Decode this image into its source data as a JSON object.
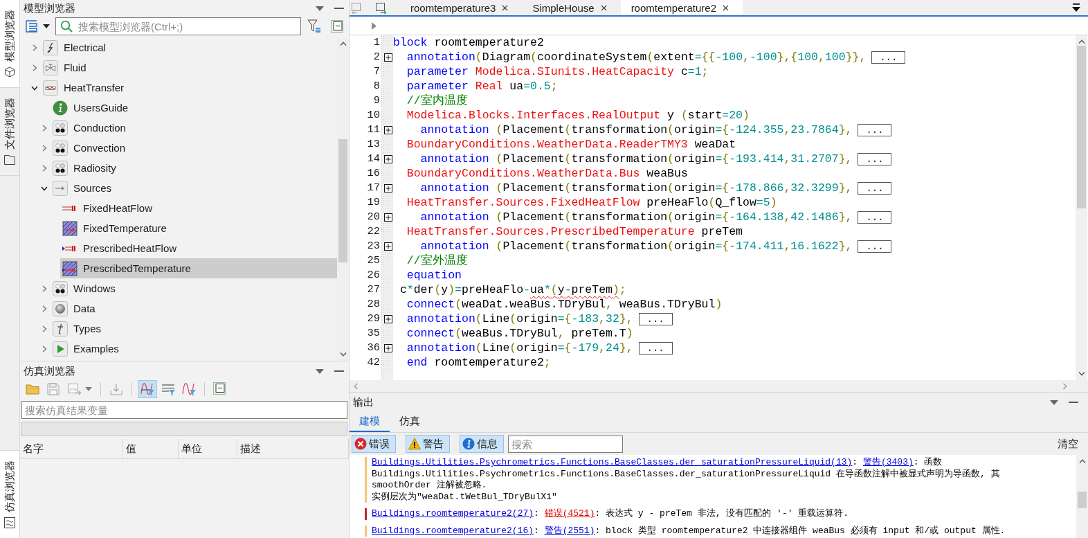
{
  "side_tabs": {
    "top": [
      {
        "label": "模型浏览器",
        "kind": "cube",
        "selected": true
      },
      {
        "label": "文件浏览器",
        "kind": "folder",
        "selected": false
      }
    ],
    "bottom": [
      {
        "label": "仿真浏览器",
        "kind": "wave",
        "selected": true
      }
    ]
  },
  "model_browser": {
    "title": "模型浏览器",
    "search": {
      "placeholder": "搜索模型浏览器(Ctrl+;)"
    },
    "tree": [
      {
        "label": "Electrical",
        "kind": "bolt",
        "expanded": false,
        "selected": false
      },
      {
        "label": "Fluid",
        "kind": "valve",
        "expanded": false,
        "selected": false
      },
      {
        "label": "HeatTransfer",
        "kind": "heat",
        "expanded": true,
        "selected": false,
        "children": [
          {
            "label": "UsersGuide",
            "kind": "info",
            "selected": false
          },
          {
            "label": "Conduction",
            "kind": "dots",
            "expanded": false,
            "selected": false
          },
          {
            "label": "Convection",
            "kind": "dots",
            "expanded": false,
            "selected": false
          },
          {
            "label": "Radiosity",
            "kind": "dots",
            "expanded": false,
            "selected": false
          },
          {
            "label": "Sources",
            "kind": "arrow",
            "expanded": true,
            "selected": false,
            "children": [
              {
                "label": "FixedHeatFlow",
                "kind": "flow",
                "selected": false
              },
              {
                "label": "FixedTemperature",
                "kind": "hatch",
                "selected": false
              },
              {
                "label": "PrescribedHeatFlow",
                "kind": "inflow",
                "selected": false
              },
              {
                "label": "PrescribedTemperature",
                "kind": "hatchin",
                "selected": true
              }
            ]
          },
          {
            "label": "Windows",
            "kind": "dots",
            "expanded": false,
            "selected": false
          },
          {
            "label": "Data",
            "kind": "disc",
            "expanded": false,
            "selected": false
          },
          {
            "label": "Types",
            "kind": "letter",
            "expanded": false,
            "selected": false
          },
          {
            "label": "Examples",
            "kind": "play",
            "expanded": false,
            "selected": false
          }
        ]
      }
    ]
  },
  "simulation_browser": {
    "title": "仿真浏览器",
    "toolbar": [
      {
        "kind": "open",
        "disabled": false,
        "selected": false
      },
      {
        "kind": "save",
        "disabled": true,
        "selected": false
      },
      {
        "kind": "export",
        "disabled": true,
        "selected": false
      },
      {
        "kind": "separator"
      },
      {
        "kind": "import",
        "disabled": true,
        "selected": false
      },
      {
        "kind": "separator"
      },
      {
        "kind": "plot",
        "disabled": false,
        "selected": true
      },
      {
        "kind": "list",
        "disabled": false,
        "selected": false
      },
      {
        "kind": "curve",
        "disabled": false,
        "selected": false
      },
      {
        "kind": "separator"
      },
      {
        "kind": "collapse",
        "disabled": false,
        "selected": false
      }
    ],
    "search": {
      "placeholder": "搜索仿真结果变量"
    },
    "table": {
      "columns": [
        "名字",
        "值",
        "单位",
        "描述"
      ]
    }
  },
  "editor": {
    "tabs": [
      {
        "label": "roomtemperature3",
        "selected": false
      },
      {
        "label": "SimpleHouse",
        "selected": false
      },
      {
        "label": "roomtemperature2",
        "selected": true
      }
    ],
    "lines": [
      {
        "number": "1",
        "segments": [
          {
            "kind": "keyword",
            "text": "block"
          },
          {
            "kind": "text",
            "text": " roomtemperature2"
          }
        ]
      },
      {
        "number": "2",
        "folded": true,
        "ellipsis": "...",
        "segments": [
          {
            "kind": "keyword",
            "text": "  annotation"
          },
          {
            "kind": "bracket",
            "text": "("
          },
          {
            "kind": "text",
            "text": "Diagram"
          },
          {
            "kind": "bracket",
            "text": "("
          },
          {
            "kind": "text",
            "text": "coordinateSystem"
          },
          {
            "kind": "bracket",
            "text": "("
          },
          {
            "kind": "text",
            "text": "extent"
          },
          {
            "kind": "number",
            "text": "="
          },
          {
            "kind": "bracket",
            "text": "{{"
          },
          {
            "kind": "number",
            "text": "-100"
          },
          {
            "kind": "bracket",
            "text": ","
          },
          {
            "kind": "number",
            "text": "-100"
          },
          {
            "kind": "bracket",
            "text": "},{"
          },
          {
            "kind": "number",
            "text": "100"
          },
          {
            "kind": "bracket",
            "text": ","
          },
          {
            "kind": "number",
            "text": "100"
          },
          {
            "kind": "bracket",
            "text": "}},"
          }
        ]
      },
      {
        "number": "7",
        "segments": [
          {
            "kind": "keyword",
            "text": "  parameter"
          },
          {
            "kind": "type",
            "text": " Modelica.SIunits.HeatCapacity"
          },
          {
            "kind": "text",
            "text": " c"
          },
          {
            "kind": "number",
            "text": "=1"
          },
          {
            "kind": "bracket",
            "text": ";"
          }
        ]
      },
      {
        "number": "8",
        "segments": [
          {
            "kind": "keyword",
            "text": "  parameter"
          },
          {
            "kind": "type",
            "text": " Real"
          },
          {
            "kind": "text",
            "text": " ua"
          },
          {
            "kind": "number",
            "text": "=0.5"
          },
          {
            "kind": "bracket",
            "text": ";"
          }
        ]
      },
      {
        "number": "9",
        "segments": [
          {
            "kind": "comment",
            "text": "  //室内温度"
          }
        ]
      },
      {
        "number": "10",
        "segments": [
          {
            "kind": "type",
            "text": "  Modelica.Blocks.Interfaces.RealOutput"
          },
          {
            "kind": "text",
            "text": " y "
          },
          {
            "kind": "bracket",
            "text": "("
          },
          {
            "kind": "text",
            "text": "start"
          },
          {
            "kind": "number",
            "text": "=20"
          },
          {
            "kind": "bracket",
            "text": ")"
          }
        ]
      },
      {
        "number": "11",
        "folded": true,
        "ellipsis": "...",
        "segments": [
          {
            "kind": "keyword",
            "text": "    annotation"
          },
          {
            "kind": "bracket",
            "text": " ("
          },
          {
            "kind": "text",
            "text": "Placement"
          },
          {
            "kind": "bracket",
            "text": "("
          },
          {
            "kind": "text",
            "text": "transformation"
          },
          {
            "kind": "bracket",
            "text": "("
          },
          {
            "kind": "text",
            "text": "origin"
          },
          {
            "kind": "number",
            "text": "="
          },
          {
            "kind": "bracket",
            "text": "{"
          },
          {
            "kind": "number",
            "text": "-124.355"
          },
          {
            "kind": "bracket",
            "text": ","
          },
          {
            "kind": "number",
            "text": "23.7864"
          },
          {
            "kind": "bracket",
            "text": "},"
          }
        ]
      },
      {
        "number": "13",
        "segments": [
          {
            "kind": "type",
            "text": "  BoundaryConditions.WeatherData.ReaderTMY3"
          },
          {
            "kind": "text",
            "text": " weaDat"
          }
        ]
      },
      {
        "number": "14",
        "folded": true,
        "ellipsis": "...",
        "segments": [
          {
            "kind": "keyword",
            "text": "    annotation"
          },
          {
            "kind": "bracket",
            "text": " ("
          },
          {
            "kind": "text",
            "text": "Placement"
          },
          {
            "kind": "bracket",
            "text": "("
          },
          {
            "kind": "text",
            "text": "transformation"
          },
          {
            "kind": "bracket",
            "text": "("
          },
          {
            "kind": "text",
            "text": "origin"
          },
          {
            "kind": "number",
            "text": "="
          },
          {
            "kind": "bracket",
            "text": "{"
          },
          {
            "kind": "number",
            "text": "-193.414"
          },
          {
            "kind": "bracket",
            "text": ","
          },
          {
            "kind": "number",
            "text": "31.2707"
          },
          {
            "kind": "bracket",
            "text": "},"
          }
        ]
      },
      {
        "number": "16",
        "segments": [
          {
            "kind": "type",
            "text": "  BoundaryConditions.WeatherData.Bus"
          },
          {
            "kind": "text",
            "text": " weaBus"
          }
        ]
      },
      {
        "number": "17",
        "folded": true,
        "ellipsis": "...",
        "segments": [
          {
            "kind": "keyword",
            "text": "    annotation"
          },
          {
            "kind": "bracket",
            "text": " ("
          },
          {
            "kind": "text",
            "text": "Placement"
          },
          {
            "kind": "bracket",
            "text": "("
          },
          {
            "kind": "text",
            "text": "transformation"
          },
          {
            "kind": "bracket",
            "text": "("
          },
          {
            "kind": "text",
            "text": "origin"
          },
          {
            "kind": "number",
            "text": "="
          },
          {
            "kind": "bracket",
            "text": "{"
          },
          {
            "kind": "number",
            "text": "-178.866"
          },
          {
            "kind": "bracket",
            "text": ","
          },
          {
            "kind": "number",
            "text": "32.3299"
          },
          {
            "kind": "bracket",
            "text": "},"
          }
        ]
      },
      {
        "number": "19",
        "segments": [
          {
            "kind": "type",
            "text": "  HeatTransfer.Sources.FixedHeatFlow"
          },
          {
            "kind": "text",
            "text": " preHeaFlo"
          },
          {
            "kind": "bracket",
            "text": "("
          },
          {
            "kind": "text",
            "text": "Q_flow"
          },
          {
            "kind": "number",
            "text": "=5"
          },
          {
            "kind": "bracket",
            "text": ")"
          }
        ]
      },
      {
        "number": "20",
        "folded": true,
        "ellipsis": "...",
        "segments": [
          {
            "kind": "keyword",
            "text": "    annotation"
          },
          {
            "kind": "bracket",
            "text": " ("
          },
          {
            "kind": "text",
            "text": "Placement"
          },
          {
            "kind": "bracket",
            "text": "("
          },
          {
            "kind": "text",
            "text": "transformation"
          },
          {
            "kind": "bracket",
            "text": "("
          },
          {
            "kind": "text",
            "text": "origin"
          },
          {
            "kind": "number",
            "text": "="
          },
          {
            "kind": "bracket",
            "text": "{"
          },
          {
            "kind": "number",
            "text": "-164.138"
          },
          {
            "kind": "bracket",
            "text": ","
          },
          {
            "kind": "number",
            "text": "42.1486"
          },
          {
            "kind": "bracket",
            "text": "},"
          }
        ]
      },
      {
        "number": "22",
        "segments": [
          {
            "kind": "type",
            "text": "  HeatTransfer.Sources.PrescribedTemperature"
          },
          {
            "kind": "text",
            "text": " preTem"
          }
        ]
      },
      {
        "number": "23",
        "folded": true,
        "ellipsis": "...",
        "segments": [
          {
            "kind": "keyword",
            "text": "    annotation"
          },
          {
            "kind": "bracket",
            "text": " ("
          },
          {
            "kind": "text",
            "text": "Placement"
          },
          {
            "kind": "bracket",
            "text": "("
          },
          {
            "kind": "text",
            "text": "transformation"
          },
          {
            "kind": "bracket",
            "text": "("
          },
          {
            "kind": "text",
            "text": "origin"
          },
          {
            "kind": "number",
            "text": "="
          },
          {
            "kind": "bracket",
            "text": "{"
          },
          {
            "kind": "number",
            "text": "-174.411"
          },
          {
            "kind": "bracket",
            "text": ","
          },
          {
            "kind": "number",
            "text": "16.1622"
          },
          {
            "kind": "bracket",
            "text": "},"
          }
        ]
      },
      {
        "number": "25",
        "segments": [
          {
            "kind": "comment",
            "text": "  //室外温度"
          }
        ]
      },
      {
        "number": "26",
        "segments": [
          {
            "kind": "keyword",
            "text": "  equation"
          }
        ]
      },
      {
        "number": "27",
        "segments": [
          {
            "kind": "text",
            "text": " c"
          },
          {
            "kind": "number",
            "text": "*"
          },
          {
            "kind": "text",
            "text": "der"
          },
          {
            "kind": "bracket",
            "text": "("
          },
          {
            "kind": "text",
            "text": "y"
          },
          {
            "kind": "bracket",
            "text": ")"
          },
          {
            "kind": "number",
            "text": "="
          },
          {
            "kind": "text",
            "text": "preHeaFlo"
          },
          {
            "kind": "number",
            "text": "-"
          },
          {
            "kind": "text",
            "text": "ua",
            "error": true
          },
          {
            "kind": "number",
            "text": "*",
            "error": true
          },
          {
            "kind": "bracket",
            "text": "(",
            "error": true
          },
          {
            "kind": "text",
            "text": "y",
            "error": true
          },
          {
            "kind": "number",
            "text": "-",
            "error": true
          },
          {
            "kind": "text",
            "text": "preTem",
            "error": true
          },
          {
            "kind": "bracket",
            "text": ")",
            "error": true
          },
          {
            "kind": "bracket",
            "text": ";"
          }
        ]
      },
      {
        "number": "28",
        "segments": [
          {
            "kind": "keyword",
            "text": "  connect"
          },
          {
            "kind": "bracket",
            "text": "("
          },
          {
            "kind": "text",
            "text": "weaDat.weaBus.TDryBul"
          },
          {
            "kind": "bracket",
            "text": ","
          },
          {
            "kind": "text",
            "text": " weaBus.TDryBul"
          },
          {
            "kind": "bracket",
            "text": ")"
          }
        ]
      },
      {
        "number": "29",
        "folded": true,
        "ellipsis": "...",
        "segments": [
          {
            "kind": "keyword",
            "text": "  annotation"
          },
          {
            "kind": "bracket",
            "text": "("
          },
          {
            "kind": "text",
            "text": "Line"
          },
          {
            "kind": "bracket",
            "text": "("
          },
          {
            "kind": "text",
            "text": "origin"
          },
          {
            "kind": "number",
            "text": "="
          },
          {
            "kind": "bracket",
            "text": "{"
          },
          {
            "kind": "number",
            "text": "-183"
          },
          {
            "kind": "bracket",
            "text": ","
          },
          {
            "kind": "number",
            "text": "32"
          },
          {
            "kind": "bracket",
            "text": "},"
          }
        ]
      },
      {
        "number": "35",
        "segments": [
          {
            "kind": "keyword",
            "text": "  connect"
          },
          {
            "kind": "bracket",
            "text": "("
          },
          {
            "kind": "text",
            "text": "weaBus.TDryBul"
          },
          {
            "kind": "bracket",
            "text": ","
          },
          {
            "kind": "text",
            "text": " preTem.T"
          },
          {
            "kind": "bracket",
            "text": ")"
          }
        ]
      },
      {
        "number": "36",
        "folded": true,
        "ellipsis": "...",
        "segments": [
          {
            "kind": "keyword",
            "text": "  annotation"
          },
          {
            "kind": "bracket",
            "text": "("
          },
          {
            "kind": "text",
            "text": "Line"
          },
          {
            "kind": "bracket",
            "text": "("
          },
          {
            "kind": "text",
            "text": "origin"
          },
          {
            "kind": "number",
            "text": "="
          },
          {
            "kind": "bracket",
            "text": "{"
          },
          {
            "kind": "number",
            "text": "-179"
          },
          {
            "kind": "bracket",
            "text": ","
          },
          {
            "kind": "number",
            "text": "24"
          },
          {
            "kind": "bracket",
            "text": "},"
          }
        ]
      },
      {
        "number": "42",
        "segments": [
          {
            "kind": "keyword",
            "text": "  end"
          },
          {
            "kind": "text",
            "text": " roomtemperature2"
          },
          {
            "kind": "bracket",
            "text": ";"
          }
        ]
      }
    ]
  },
  "output": {
    "title": "输出",
    "tabs": [
      {
        "label": "建模",
        "selected": true
      },
      {
        "label": "仿真",
        "selected": false
      }
    ],
    "filters": [
      {
        "kind": "error",
        "label": "错误",
        "selected": true
      },
      {
        "kind": "warning",
        "label": "警告",
        "selected": true
      },
      {
        "kind": "info",
        "label": "信息",
        "selected": true
      }
    ],
    "search": {
      "placeholder": "搜索"
    },
    "clear": "清空",
    "messages": [
      {
        "kind": "warning",
        "parts": [
          {
            "kind": "source",
            "text": "Buildings.Utilities.Psychrometrics.Functions.BaseClasses.der_saturationPressureLiquid(13)"
          },
          {
            "kind": "text",
            "text": ": "
          },
          {
            "kind": "level",
            "text": "警告(3403)"
          },
          {
            "kind": "text",
            "text": ": 函数\nBuildings.Utilities.Psychrometrics.Functions.BaseClasses.der_saturationPressureLiquid 在导函数注解中被显式声明为导函数, 其\nsmoothOrder 注解被忽略.\n实例层次为\"weaDat.tWetBul_TDryBulXi\""
          }
        ]
      },
      {
        "kind": "error",
        "parts": [
          {
            "kind": "source",
            "text": "Buildings.roomtemperature2(27)"
          },
          {
            "kind": "text",
            "text": ": "
          },
          {
            "kind": "level",
            "text": "错误(4521)"
          },
          {
            "kind": "text",
            "text": ": 表达式 y - preTem 非法, 没有匹配的 '-' 重载运算符."
          }
        ]
      },
      {
        "kind": "warning",
        "parts": [
          {
            "kind": "source",
            "text": "Buildings.roomtemperature2(16)"
          },
          {
            "kind": "text",
            "text": ": "
          },
          {
            "kind": "level",
            "text": "警告(2551)"
          },
          {
            "kind": "text",
            "text": ": block 类型 roomtemperature2 中连接器组件 weaBus 必须有 input 和/或 output 属性."
          }
        ]
      }
    ]
  }
}
